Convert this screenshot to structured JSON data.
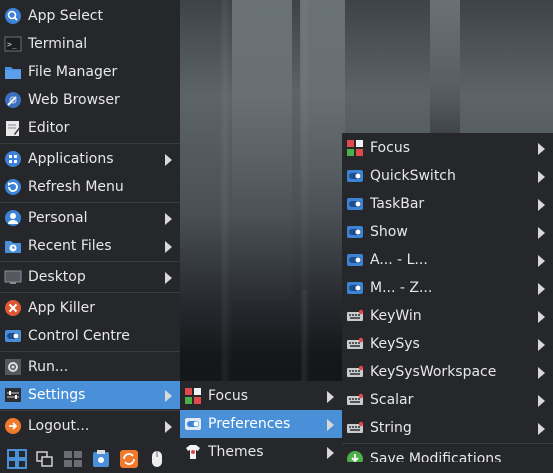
{
  "main_menu": {
    "items": [
      {
        "label": "App Select",
        "accent": "A"
      },
      {
        "label": "Terminal",
        "accent": "T"
      },
      {
        "label": "File Manager",
        "accent": "F"
      },
      {
        "label": "Web Browser",
        "accent": "W"
      },
      {
        "label": "Editor",
        "accent": "E"
      },
      {
        "label": "Applications",
        "accent": "A"
      },
      {
        "label": "Refresh Menu",
        "accent": "R"
      },
      {
        "label": "Personal",
        "accent": "P"
      },
      {
        "label": "Recent Files",
        "accent": "R"
      },
      {
        "label": "Desktop",
        "accent": "D"
      },
      {
        "label": "App Killer",
        "accent": "A"
      },
      {
        "label": "Control Centre",
        "accent": "C"
      },
      {
        "label": "Run...",
        "accent": "R"
      },
      {
        "label": "Settings",
        "accent": "S"
      },
      {
        "label": "Logout...",
        "accent": "L"
      }
    ]
  },
  "settings_menu": {
    "items": [
      {
        "label": "Focus",
        "accent": "F"
      },
      {
        "label": "Preferences",
        "accent": "P"
      },
      {
        "label": "Themes",
        "accent": "T"
      }
    ]
  },
  "preferences_menu": {
    "items": [
      {
        "label": "Focus",
        "accent": "F"
      },
      {
        "label": "QuickSwitch",
        "accent": "Q"
      },
      {
        "label": "TaskBar",
        "accent": "T"
      },
      {
        "label": "Show",
        "accent": "S"
      },
      {
        "label": "A... - L...",
        "accent": "A"
      },
      {
        "label": "M... - Z...",
        "accent": "M"
      },
      {
        "label": "KeyWin",
        "accent": "K"
      },
      {
        "label": "KeySys",
        "accent": "K"
      },
      {
        "label": "KeySysWorkspace",
        "accent": "K"
      },
      {
        "label": "Scalar",
        "accent": "S"
      },
      {
        "label": "String",
        "accent": "S"
      },
      {
        "label": "Save Modifications",
        "accent": "S"
      }
    ]
  },
  "taskbar": {
    "icons": [
      "start-menu-icon",
      "show-windows-icon",
      "workspace-icon",
      "file-manager-icon",
      "refresh-icon",
      "mouse-icon"
    ]
  },
  "colors": {
    "menu_bg": "#25272b",
    "highlight": "#4a90d9",
    "text": "#e8e8e8"
  }
}
